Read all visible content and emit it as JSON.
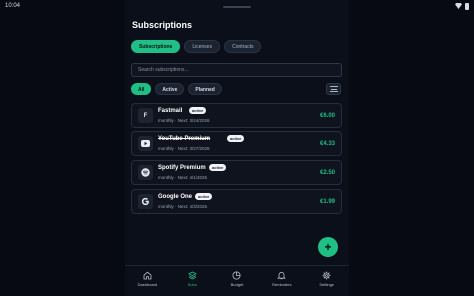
{
  "status_bar": {
    "time": "10:04"
  },
  "header": {
    "title": "Subscriptions"
  },
  "tabs": [
    {
      "label": "Subscriptions",
      "active": true
    },
    {
      "label": "Licenses",
      "active": false
    },
    {
      "label": "Contracts",
      "active": false
    }
  ],
  "search": {
    "placeholder": "Search subscriptions..."
  },
  "filters": [
    {
      "label": "All",
      "active": true
    },
    {
      "label": "Active",
      "active": false
    },
    {
      "label": "Planned",
      "active": false
    }
  ],
  "subscriptions": [
    {
      "logo": "F",
      "name": "Fastmail",
      "badge": "active",
      "meta": "monthly · Next: 3/24/2026",
      "price": "€6.00",
      "strikethrough": false
    },
    {
      "logo": "youtube-icon",
      "name": "YouTube Premium",
      "badge": "active",
      "meta": "monthly · Next: 3/27/2026",
      "price": "€4.33",
      "strikethrough": true
    },
    {
      "logo": "spotify-icon",
      "name": "Spotify Premium",
      "badge": "active",
      "meta": "monthly · Next: 4/1/2026",
      "price": "€2.50",
      "strikethrough": false
    },
    {
      "logo": "google-icon",
      "name": "Google One",
      "badge": "active",
      "meta": "monthly · Next: 4/3/2026",
      "price": "€1.99",
      "strikethrough": false
    }
  ],
  "fab": {
    "label": "+"
  },
  "nav": [
    {
      "label": "Dashboard",
      "icon": "home-icon",
      "active": false
    },
    {
      "label": "Subs",
      "icon": "layers-icon",
      "active": true
    },
    {
      "label": "Budget",
      "icon": "pie-chart-icon",
      "active": false
    },
    {
      "label": "Reminders",
      "icon": "bell-icon",
      "active": false
    },
    {
      "label": "Settings",
      "icon": "gear-icon",
      "active": false
    }
  ],
  "colors": {
    "accent": "#1fbf86",
    "background": "#0b0f1a",
    "card": "#0e131e"
  }
}
